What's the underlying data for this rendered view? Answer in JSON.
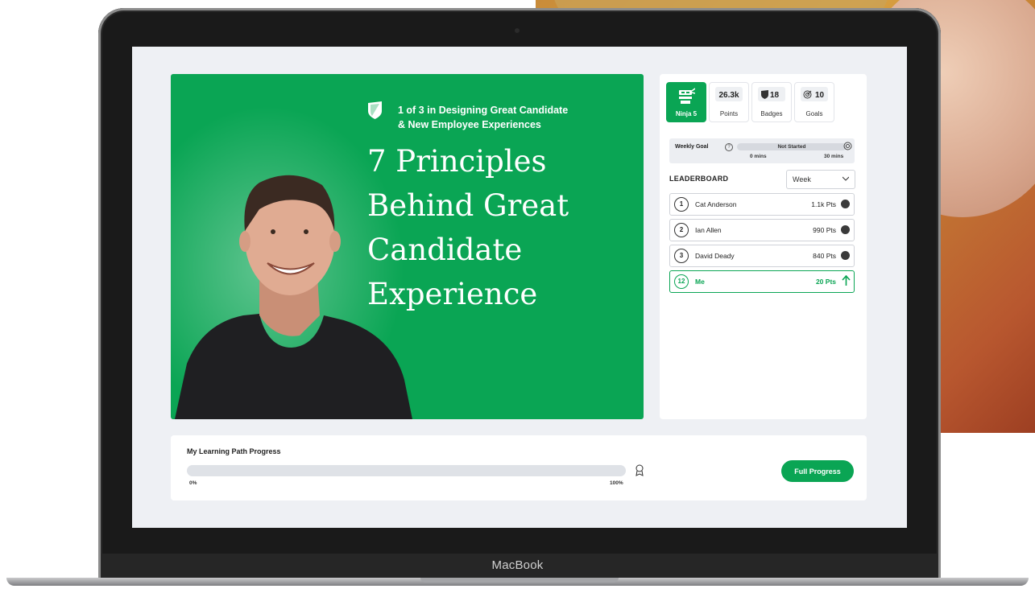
{
  "device": {
    "brand_label": "MacBook"
  },
  "hero": {
    "series_line1": "1 of 3 in Designing Great Candidate",
    "series_line2": "& New Employee Experiences",
    "title_lines": [
      "7 Principles",
      "Behind Great",
      "Candidate",
      "Experience"
    ],
    "background_color": "#0aa554"
  },
  "stats": {
    "ninja": {
      "label": "Ninja 5",
      "icon": "ninja-icon"
    },
    "points": {
      "value": "26.3k",
      "label": "Points"
    },
    "badges": {
      "value": "18",
      "label": "Badges",
      "icon": "badge-icon"
    },
    "goals": {
      "value": "10",
      "label": "Goals",
      "icon": "target-icon"
    }
  },
  "weekly_goal": {
    "label": "Weekly Goal",
    "status": "Not Started",
    "min_label": "0 mins",
    "max_label": "30 mins"
  },
  "leaderboard": {
    "title": "LEADERBOARD",
    "period": "Week",
    "rows": [
      {
        "rank": "1",
        "name": "Cat Anderson",
        "points": "1.1k Pts"
      },
      {
        "rank": "2",
        "name": "Ian Allen",
        "points": "990 Pts"
      },
      {
        "rank": "3",
        "name": "David Deady",
        "points": "840 Pts"
      },
      {
        "rank": "12",
        "name": "Me",
        "points": "20 Pts"
      }
    ]
  },
  "learning_path": {
    "title": "My Learning Path Progress",
    "progress_fraction": 0,
    "start_label": "0%",
    "end_label": "100%",
    "button_label": "Full Progress"
  },
  "colors": {
    "accent": "#0aa554",
    "screen_bg": "#eef0f4"
  }
}
